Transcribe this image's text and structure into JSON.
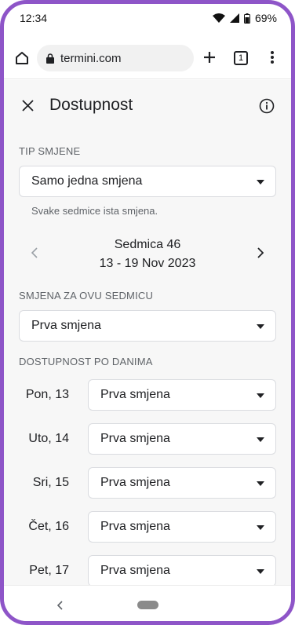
{
  "status_bar": {
    "time": "12:34",
    "battery": "69%"
  },
  "browser": {
    "url": "termini.com",
    "tab_count": "1"
  },
  "header": {
    "title": "Dostupnost"
  },
  "shift_type": {
    "label": "TIP SMJENE",
    "selected": "Samo jedna smjena",
    "helper": "Svake sedmice ista smjena."
  },
  "week": {
    "name": "Sedmica 46",
    "range": "13 - 19 Nov 2023"
  },
  "week_shift": {
    "label": "SMJENA ZA OVU SEDMICU",
    "selected": "Prva smjena"
  },
  "days": {
    "label": "DOSTUPNOST PO DANIMA",
    "items": [
      {
        "day": "Pon, 13",
        "shift": "Prva smjena"
      },
      {
        "day": "Uto, 14",
        "shift": "Prva smjena"
      },
      {
        "day": "Sri, 15",
        "shift": "Prva smjena"
      },
      {
        "day": "Čet, 16",
        "shift": "Prva smjena"
      },
      {
        "day": "Pet, 17",
        "shift": "Prva smjena"
      }
    ]
  },
  "colors": {
    "frame": "#8e55c8",
    "page_bg": "#f7f7f7"
  }
}
